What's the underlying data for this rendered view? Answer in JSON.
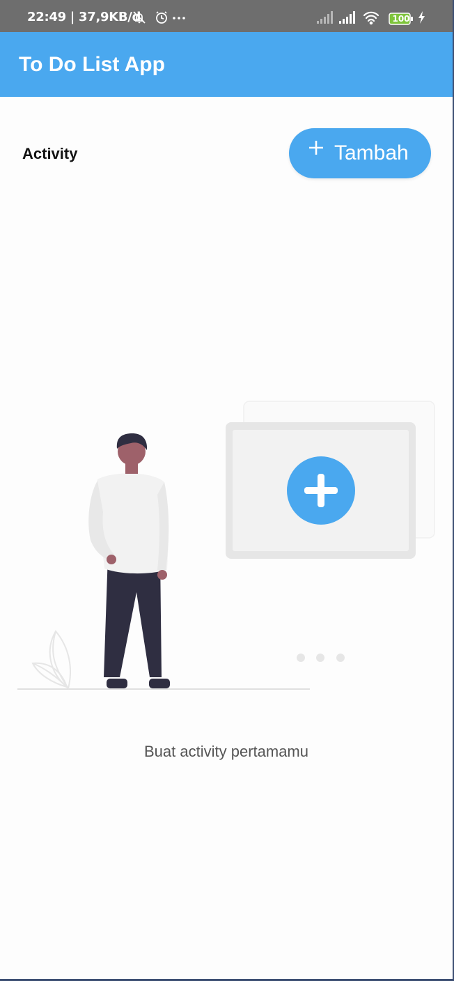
{
  "status_bar": {
    "time_net": "22:49 | 37,9KB/d",
    "battery": "100",
    "icons": [
      "mute-icon",
      "alarm-icon",
      "more-dots-icon",
      "signal-icon",
      "signal-icon",
      "wifi-icon",
      "battery-icon",
      "charging-icon"
    ]
  },
  "app_bar": {
    "title": "To Do List App"
  },
  "header": {
    "label": "Activity",
    "add_button": {
      "icon": "plus-icon",
      "label": "Tambah"
    }
  },
  "empty_state": {
    "message": "Buat activity pertamamu"
  },
  "colors": {
    "primary": "#4aa8ef",
    "status_bar": "#6e6e6e"
  }
}
